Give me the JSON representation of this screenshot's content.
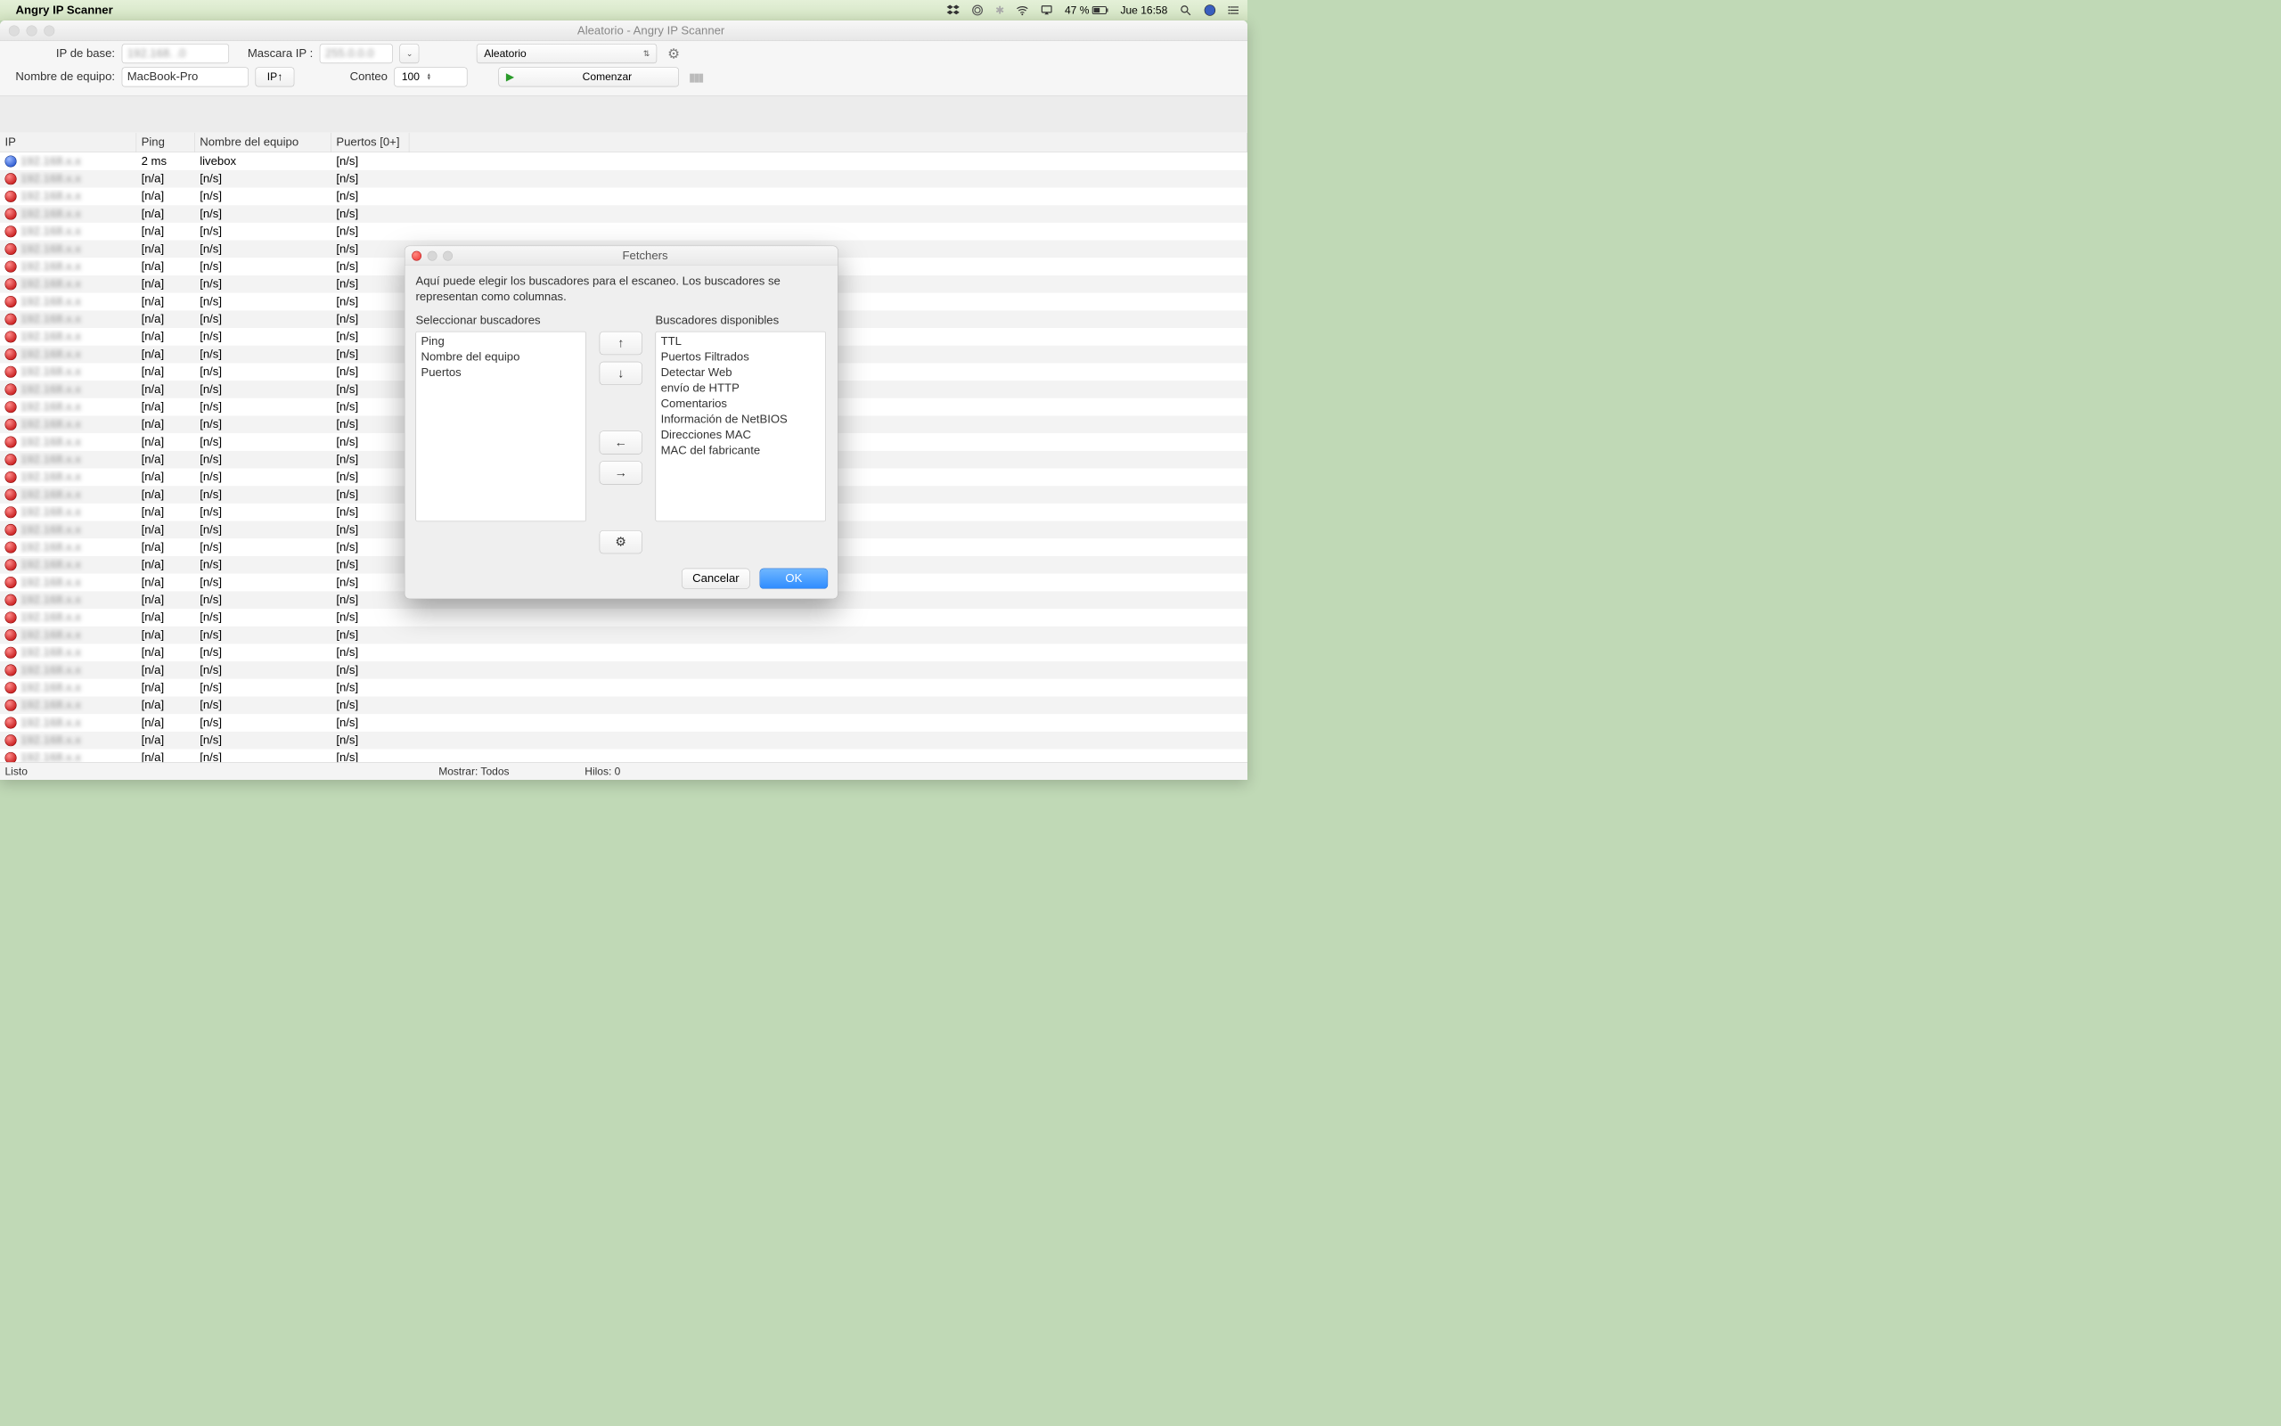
{
  "menubar": {
    "appname": "Angry IP Scanner",
    "battery": "47 %",
    "clock": "Jue 16:58"
  },
  "mainwin": {
    "title": "Aleatorio - Angry IP Scanner",
    "ipbase_label": "IP de base:",
    "ipbase_value": "192.168.  .0",
    "mask_label": "Mascara IP :",
    "mask_value": "255.0.0.0",
    "mask_dropdown": "⌄",
    "mode_select": "Aleatorio",
    "hostname_label": "Nombre de equipo:",
    "hostname_value": "MacBook-Pro",
    "ip_up_btn": "IP↑",
    "count_label": "Conteo",
    "count_value": "100",
    "start_btn": "Comenzar",
    "columns": {
      "ip": "IP",
      "ping": "Ping",
      "host": "Nombre del equipo",
      "ports": "Puertos [0+]"
    },
    "rows": [
      {
        "s": "blue",
        "ip": "192.168.x.x",
        "ping": "2 ms",
        "host": "livebox",
        "ports": "[n/s]"
      },
      {
        "s": "red",
        "ip": "192.168.x.x",
        "ping": "[n/a]",
        "host": "[n/s]",
        "ports": "[n/s]"
      },
      {
        "s": "red",
        "ip": "192.168.x.x",
        "ping": "[n/a]",
        "host": "[n/s]",
        "ports": "[n/s]"
      },
      {
        "s": "red",
        "ip": "192.168.x.x",
        "ping": "[n/a]",
        "host": "[n/s]",
        "ports": "[n/s]"
      },
      {
        "s": "red",
        "ip": "192.168.x.x",
        "ping": "[n/a]",
        "host": "[n/s]",
        "ports": "[n/s]"
      },
      {
        "s": "red",
        "ip": "192.168.x.x",
        "ping": "[n/a]",
        "host": "[n/s]",
        "ports": "[n/s]"
      },
      {
        "s": "red",
        "ip": "192.168.x.x",
        "ping": "[n/a]",
        "host": "[n/s]",
        "ports": "[n/s]"
      },
      {
        "s": "red",
        "ip": "192.168.x.x",
        "ping": "[n/a]",
        "host": "[n/s]",
        "ports": "[n/s]"
      },
      {
        "s": "red",
        "ip": "192.168.x.x",
        "ping": "[n/a]",
        "host": "[n/s]",
        "ports": "[n/s]"
      },
      {
        "s": "red",
        "ip": "192.168.x.x",
        "ping": "[n/a]",
        "host": "[n/s]",
        "ports": "[n/s]"
      },
      {
        "s": "red",
        "ip": "192.168.x.x",
        "ping": "[n/a]",
        "host": "[n/s]",
        "ports": "[n/s]"
      },
      {
        "s": "red",
        "ip": "192.168.x.x",
        "ping": "[n/a]",
        "host": "[n/s]",
        "ports": "[n/s]"
      },
      {
        "s": "red",
        "ip": "192.168.x.x",
        "ping": "[n/a]",
        "host": "[n/s]",
        "ports": "[n/s]"
      },
      {
        "s": "red",
        "ip": "192.168.x.x",
        "ping": "[n/a]",
        "host": "[n/s]",
        "ports": "[n/s]"
      },
      {
        "s": "red",
        "ip": "192.168.x.x",
        "ping": "[n/a]",
        "host": "[n/s]",
        "ports": "[n/s]"
      },
      {
        "s": "red",
        "ip": "192.168.x.x",
        "ping": "[n/a]",
        "host": "[n/s]",
        "ports": "[n/s]"
      },
      {
        "s": "red",
        "ip": "192.168.x.x",
        "ping": "[n/a]",
        "host": "[n/s]",
        "ports": "[n/s]"
      },
      {
        "s": "red",
        "ip": "192.168.x.x",
        "ping": "[n/a]",
        "host": "[n/s]",
        "ports": "[n/s]"
      },
      {
        "s": "red",
        "ip": "192.168.x.x",
        "ping": "[n/a]",
        "host": "[n/s]",
        "ports": "[n/s]"
      },
      {
        "s": "red",
        "ip": "192.168.x.x",
        "ping": "[n/a]",
        "host": "[n/s]",
        "ports": "[n/s]"
      },
      {
        "s": "red",
        "ip": "192.168.x.x",
        "ping": "[n/a]",
        "host": "[n/s]",
        "ports": "[n/s]"
      },
      {
        "s": "red",
        "ip": "192.168.x.x",
        "ping": "[n/a]",
        "host": "[n/s]",
        "ports": "[n/s]"
      },
      {
        "s": "red",
        "ip": "192.168.x.x",
        "ping": "[n/a]",
        "host": "[n/s]",
        "ports": "[n/s]"
      },
      {
        "s": "red",
        "ip": "192.168.x.x",
        "ping": "[n/a]",
        "host": "[n/s]",
        "ports": "[n/s]"
      },
      {
        "s": "red",
        "ip": "192.168.x.x",
        "ping": "[n/a]",
        "host": "[n/s]",
        "ports": "[n/s]"
      },
      {
        "s": "red",
        "ip": "192.168.x.x",
        "ping": "[n/a]",
        "host": "[n/s]",
        "ports": "[n/s]"
      },
      {
        "s": "red",
        "ip": "192.168.x.x",
        "ping": "[n/a]",
        "host": "[n/s]",
        "ports": "[n/s]"
      },
      {
        "s": "red",
        "ip": "192.168.x.x",
        "ping": "[n/a]",
        "host": "[n/s]",
        "ports": "[n/s]"
      },
      {
        "s": "red",
        "ip": "192.168.x.x",
        "ping": "[n/a]",
        "host": "[n/s]",
        "ports": "[n/s]"
      },
      {
        "s": "red",
        "ip": "192.168.x.x",
        "ping": "[n/a]",
        "host": "[n/s]",
        "ports": "[n/s]"
      },
      {
        "s": "red",
        "ip": "192.168.x.x",
        "ping": "[n/a]",
        "host": "[n/s]",
        "ports": "[n/s]"
      },
      {
        "s": "red",
        "ip": "192.168.x.x",
        "ping": "[n/a]",
        "host": "[n/s]",
        "ports": "[n/s]"
      },
      {
        "s": "red",
        "ip": "192.168.x.x",
        "ping": "[n/a]",
        "host": "[n/s]",
        "ports": "[n/s]"
      },
      {
        "s": "red",
        "ip": "192.168.x.x",
        "ping": "[n/a]",
        "host": "[n/s]",
        "ports": "[n/s]"
      },
      {
        "s": "red",
        "ip": "192.168.x.x",
        "ping": "[n/a]",
        "host": "[n/s]",
        "ports": "[n/s]"
      }
    ]
  },
  "statusbar": {
    "ready": "Listo",
    "show": "Mostrar: Todos",
    "threads": "Hilos: 0"
  },
  "fetchers": {
    "title": "Fetchers",
    "desc": "Aquí puede elegir los buscadores para el escaneo. Los buscadores se representan como columnas.",
    "left_label": "Seleccionar buscadores",
    "right_label": "Buscadores disponibles",
    "selected": [
      "Ping",
      "Nombre del equipo",
      "Puertos"
    ],
    "available": [
      "TTL",
      "Puertos Filtrados",
      "Detectar Web",
      "envío de HTTP",
      "Comentarios",
      "Información de NetBIOS",
      "Direcciones MAC",
      "MAC del fabricante"
    ],
    "btns": {
      "up": "↑",
      "down": "↓",
      "left": "←",
      "right": "→",
      "prefs": "⚙"
    },
    "cancel": "Cancelar",
    "ok": "OK"
  }
}
